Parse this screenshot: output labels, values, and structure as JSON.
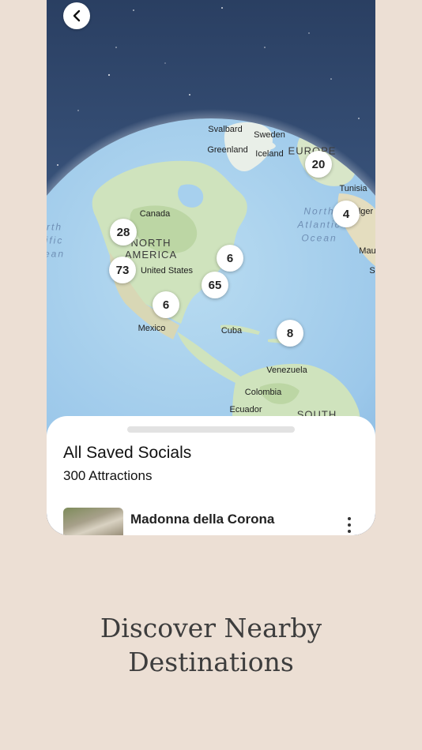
{
  "map": {
    "labels": {
      "svalbard": "Svalbard",
      "sweden": "Sweden",
      "greenland": "Greenland",
      "iceland": "Iceland",
      "europe": "EUROPE",
      "tunisia": "Tunisia",
      "algeria": "lger",
      "canada": "Canada",
      "north_america_1": "NORTH",
      "north_america_2": "AMERICA",
      "united_states": "United States",
      "mexico": "Mexico",
      "cuba": "Cuba",
      "venezuela": "Venezuela",
      "colombia": "Colombia",
      "ecuador": "Ecuador",
      "south": "SOUTH",
      "mau": "Mau",
      "s": "S",
      "pacific_1": "rth",
      "pacific_2": "ific",
      "pacific_3": "ean",
      "atlantic_1": "North",
      "atlantic_2": "Atlantic",
      "atlantic_3": "Ocean"
    },
    "clusters": [
      "20",
      "4",
      "28",
      "6",
      "73",
      "65",
      "6",
      "8"
    ]
  },
  "sheet": {
    "title": "All Saved Socials",
    "subtitle": "300 Attractions",
    "items": [
      {
        "title": "Madonna della Corona"
      }
    ]
  },
  "tagline": {
    "line1": "Discover Nearby",
    "line2": "Destinations"
  }
}
